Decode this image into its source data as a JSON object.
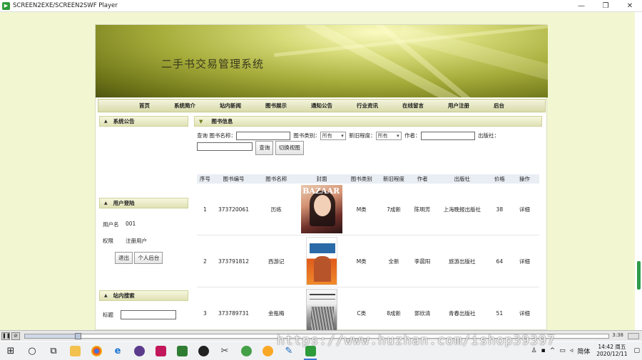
{
  "window": {
    "title": "SCREEN2EXE/SCREEN2SWF Player",
    "minimize_icon": "minimize-icon",
    "restore_icon": "restore-icon",
    "close_icon": "close-icon"
  },
  "site": {
    "title": "二手书交易管理系统",
    "nav": [
      "首页",
      "系统简介",
      "站内新闻",
      "图书展示",
      "通知公告",
      "行业资讯",
      "在线留言",
      "用户注册",
      "后台"
    ]
  },
  "left": {
    "notice_header": "系统公告",
    "login_header": "用户登陆",
    "username_label": "用户名",
    "username_value": "001",
    "role_label": "权限",
    "role_value": "注册用户",
    "logout_button": "退出",
    "personal_button": "个人后台",
    "search_header": "站内搜索",
    "search_label": "标题"
  },
  "main": {
    "header": "图书信息",
    "query": {
      "query_label": "查询",
      "name_label": "图书名称：",
      "category_label": "图书类别：",
      "category_value": "所有",
      "condition_label": "新旧程度：",
      "condition_value": "所有",
      "author_label": "作者：",
      "publisher_label": "出版社：",
      "search_button": "查询",
      "switch_view_button": "切换视图"
    },
    "columns": [
      "序号",
      "图书编号",
      "图书名称",
      "封面",
      "图书类别",
      "新旧程度",
      "作者",
      "出版社",
      "价格",
      "操作"
    ],
    "rows": [
      {
        "seq": "1",
        "code": "373720061",
        "name": "历练",
        "category": "M类",
        "condition": "7成新",
        "author": "陈明芳",
        "publisher": "上海晚报出版社",
        "price": "38",
        "action": "详细",
        "cover_text": "BAZAAR"
      },
      {
        "seq": "2",
        "code": "373791812",
        "name": "西游记",
        "category": "M类",
        "condition": "全新",
        "author": "李晨阳",
        "publisher": "旅游出版社",
        "price": "64",
        "action": "详细"
      },
      {
        "seq": "3",
        "code": "373789731",
        "name": "金瓶梅",
        "category": "C类",
        "condition": "8成新",
        "author": "郭欣清",
        "publisher": "青春出版社",
        "price": "51",
        "action": "详细"
      }
    ]
  },
  "player": {
    "time": "3:38",
    "progress": 0.09
  },
  "taskbar": {
    "ime": "简体",
    "time": "14:42 周五",
    "date": "2020/12/11"
  },
  "watermark": "https://www.huzhan.com/ishop39397"
}
